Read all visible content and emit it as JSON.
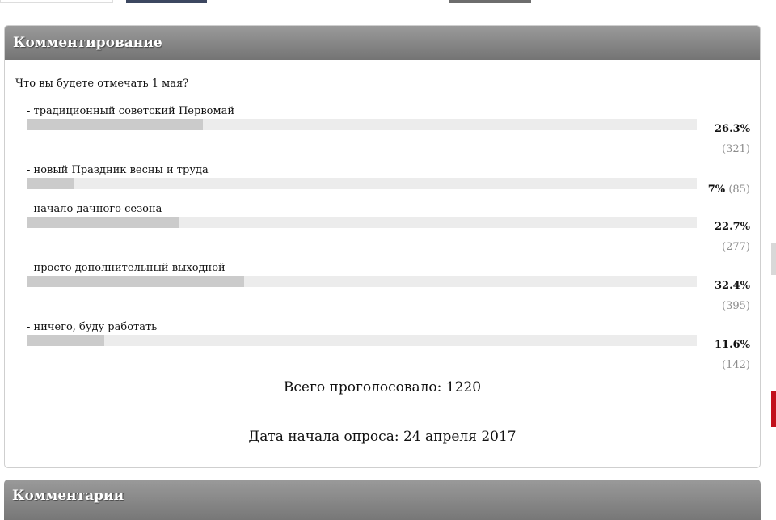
{
  "panel": {
    "title": "Комментирование"
  },
  "poll": {
    "question": "Что вы будете отмечать 1 мая?",
    "options": [
      {
        "label": "- традиционный советский Первомай",
        "percent_text": "26.3%",
        "count_text": "(321)",
        "fraction": 0.263
      },
      {
        "label": "- новый Праздник весны и труда",
        "percent_text": "7%",
        "count_text": "(85)",
        "fraction": 0.07
      },
      {
        "label": "- начало дачного сезона",
        "percent_text": "22.7%",
        "count_text": "(277)",
        "fraction": 0.227
      },
      {
        "label": "- просто дополнительный выходной",
        "percent_text": "32.4%",
        "count_text": "(395)",
        "fraction": 0.324
      },
      {
        "label": "- ничего, буду работать",
        "percent_text": "11.6%",
        "count_text": "(142)",
        "fraction": 0.116
      }
    ],
    "total_text": "Всего проголосовало: 1220",
    "start_date_text": "Дата начала опроса: 24 апреля 2017"
  },
  "comments": {
    "title": "Комментарии"
  }
}
